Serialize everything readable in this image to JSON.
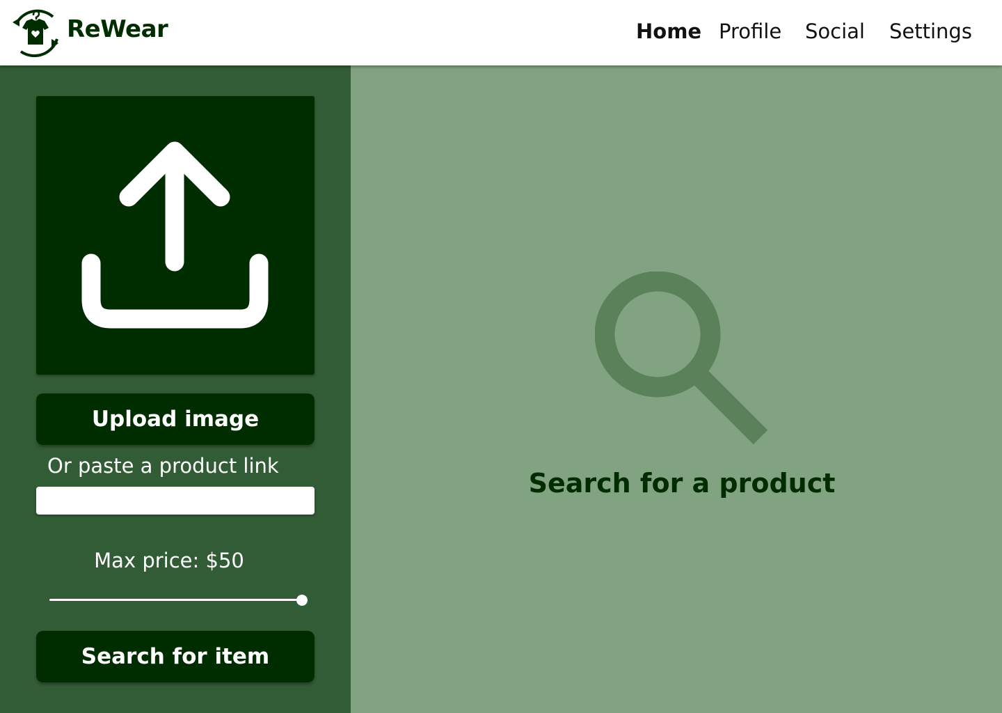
{
  "header": {
    "brand": "ReWear",
    "logo_icon": "hanger-shirt-recycle-icon",
    "nav": [
      {
        "label": "Home",
        "active": true
      },
      {
        "label": "Profile",
        "active": false
      },
      {
        "label": "Social",
        "active": false
      },
      {
        "label": "Settings",
        "active": false
      }
    ]
  },
  "sidebar": {
    "upload_icon": "upload-icon",
    "upload_button": "Upload image",
    "paste_label": "Or paste a product link",
    "link_input": {
      "value": "",
      "placeholder": ""
    },
    "price_label": "Max price: $50",
    "price_slider_fraction": 1.0,
    "search_button": "Search for item"
  },
  "main": {
    "empty_icon": "search-icon",
    "empty_text": "Search for a product"
  },
  "colors": {
    "dark_green": "#002d00",
    "sidebar_green": "#325c35",
    "main_green": "#82a381",
    "icon_green": "#5a8159",
    "white": "#ffffff"
  }
}
